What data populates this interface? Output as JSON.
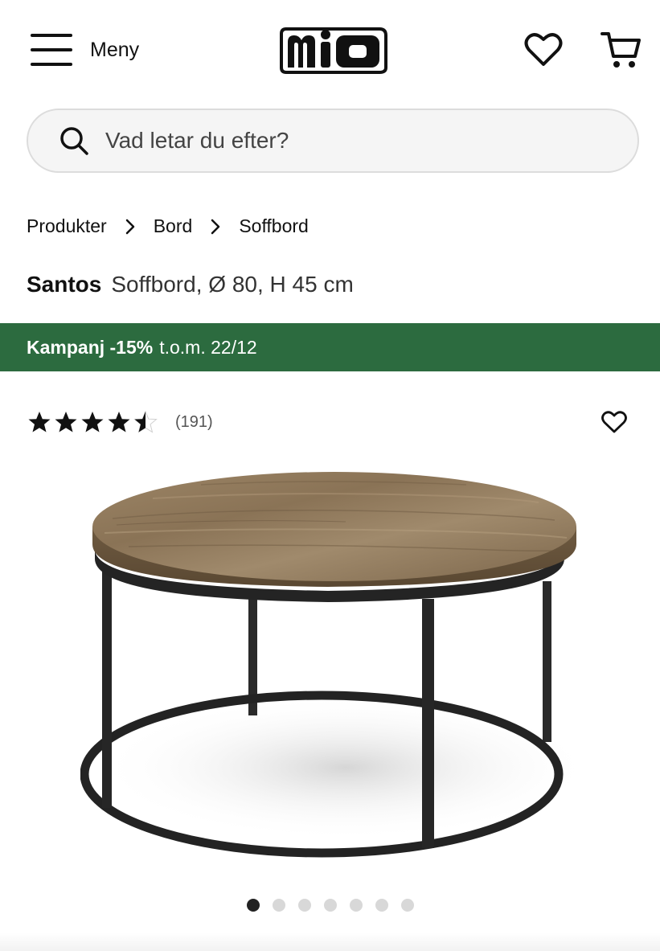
{
  "header": {
    "menu_label": "Meny",
    "logo_text": "mio",
    "icons": {
      "menu": "hamburger-icon",
      "wishlist": "heart-icon",
      "cart": "cart-icon"
    }
  },
  "search": {
    "placeholder": "Vad letar du efter?",
    "value": "",
    "icon": "search-icon"
  },
  "breadcrumb": {
    "items": [
      {
        "label": "Produkter"
      },
      {
        "label": "Bord"
      },
      {
        "label": "Soffbord"
      }
    ],
    "separator_icon": "chevron-right-icon"
  },
  "product": {
    "brand": "Santos",
    "description": "Soffbord, Ø 80, H 45 cm",
    "rating": 4.5,
    "review_count": "(191)",
    "favorite_icon": "heart-outline-icon",
    "image": "round-coffee-table-image"
  },
  "promo": {
    "label": "Kampanj -15%",
    "date": "t.o.m. 22/12",
    "color": "#2c6b3f"
  },
  "gallery": {
    "total_images": 7,
    "active_index": 0
  },
  "colors": {
    "text": "#111111",
    "promo_bg": "#2c6b3f",
    "search_bg": "#f5f5f5",
    "dot_active": "#222222",
    "dot_inactive": "#d8d8d8"
  }
}
